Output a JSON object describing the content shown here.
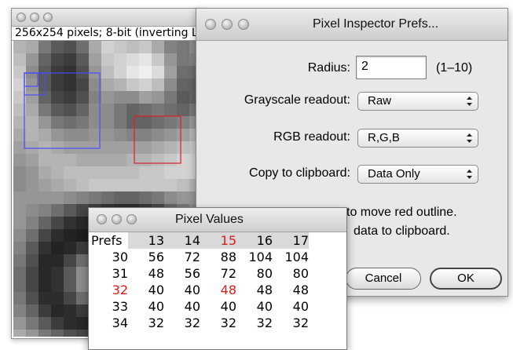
{
  "image_window": {
    "info": "256x254 pixels; 8-bit (inverting LUT)",
    "image_grid": [
      [
        180,
        170,
        120,
        90,
        80,
        110,
        170,
        210,
        200,
        190,
        200,
        170,
        130,
        120,
        140,
        170
      ],
      [
        190,
        150,
        100,
        70,
        60,
        90,
        160,
        200,
        210,
        220,
        230,
        200,
        150,
        120,
        130,
        160
      ],
      [
        200,
        140,
        90,
        60,
        50,
        80,
        150,
        190,
        210,
        230,
        240,
        220,
        160,
        110,
        110,
        150
      ],
      [
        210,
        150,
        90,
        60,
        50,
        70,
        140,
        170,
        180,
        200,
        210,
        190,
        140,
        100,
        100,
        140
      ],
      [
        200,
        160,
        100,
        70,
        60,
        80,
        130,
        150,
        140,
        140,
        160,
        150,
        120,
        90,
        100,
        140
      ],
      [
        190,
        170,
        120,
        90,
        80,
        100,
        140,
        140,
        120,
        100,
        110,
        120,
        110,
        100,
        120,
        160
      ],
      [
        180,
        180,
        150,
        120,
        110,
        120,
        140,
        140,
        120,
        100,
        100,
        110,
        120,
        130,
        150,
        180
      ],
      [
        170,
        180,
        170,
        150,
        140,
        140,
        150,
        150,
        140,
        130,
        130,
        140,
        150,
        160,
        180,
        200
      ],
      [
        160,
        170,
        180,
        170,
        160,
        160,
        160,
        160,
        160,
        160,
        160,
        170,
        180,
        190,
        200,
        210
      ],
      [
        150,
        160,
        180,
        180,
        180,
        170,
        170,
        170,
        170,
        180,
        180,
        190,
        200,
        210,
        210,
        210
      ],
      [
        140,
        150,
        170,
        180,
        190,
        190,
        190,
        190,
        190,
        190,
        200,
        200,
        210,
        210,
        210,
        200
      ],
      [
        140,
        150,
        160,
        170,
        180,
        190,
        200,
        200,
        200,
        200,
        200,
        200,
        200,
        190,
        180,
        170
      ],
      [
        150,
        150,
        150,
        150,
        140,
        130,
        120,
        110,
        100,
        100,
        110,
        120,
        140,
        150,
        150,
        150
      ],
      [
        150,
        140,
        130,
        110,
        90,
        70,
        60,
        50,
        45,
        45,
        55,
        70,
        100,
        120,
        140,
        150
      ],
      [
        150,
        130,
        100,
        70,
        50,
        40,
        35,
        30,
        30,
        30,
        35,
        45,
        70,
        100,
        130,
        150
      ],
      [
        140,
        110,
        70,
        45,
        35,
        30,
        35,
        45,
        50,
        45,
        40,
        40,
        50,
        80,
        120,
        150
      ],
      [
        130,
        90,
        50,
        35,
        40,
        60,
        90,
        110,
        110,
        90,
        60,
        45,
        40,
        60,
        110,
        150
      ],
      [
        120,
        80,
        40,
        40,
        70,
        110,
        150,
        170,
        170,
        150,
        110,
        60,
        40,
        50,
        100,
        150
      ],
      [
        110,
        70,
        40,
        50,
        90,
        140,
        180,
        200,
        200,
        180,
        140,
        80,
        45,
        50,
        100,
        150
      ],
      [
        110,
        70,
        40,
        50,
        90,
        140,
        180,
        200,
        200,
        180,
        140,
        80,
        45,
        55,
        110,
        160
      ],
      [
        120,
        80,
        45,
        45,
        70,
        110,
        150,
        170,
        170,
        150,
        110,
        60,
        45,
        70,
        130,
        170
      ],
      [
        130,
        100,
        60,
        40,
        45,
        60,
        90,
        110,
        110,
        90,
        60,
        45,
        60,
        100,
        150,
        180
      ],
      [
        150,
        120,
        90,
        60,
        45,
        40,
        45,
        50,
        50,
        45,
        45,
        60,
        100,
        140,
        170,
        190
      ],
      [
        170,
        150,
        120,
        100,
        80,
        70,
        60,
        60,
        60,
        70,
        90,
        120,
        150,
        170,
        190,
        200
      ]
    ]
  },
  "prefs_dialog": {
    "title": "Pixel Inspector Prefs...",
    "radius_label": "Radius:",
    "radius_value": "2",
    "radius_range": "(1–10)",
    "grayscale_label": "Grayscale readout:",
    "grayscale_value": "Raw",
    "rgb_label": "RGB readout:",
    "rgb_value": "R,G,B",
    "clipboard_label": "Copy to clipboard:",
    "clipboard_value": "Data Only",
    "hint_line1": "to move red outline.",
    "hint_line2": "data to clipboard.",
    "cancel_label": "Cancel",
    "ok_label": "OK"
  },
  "pixel_values_window": {
    "title": "Pixel Values",
    "corner_label": "Prefs",
    "columns": [
      "13",
      "14",
      "15",
      "16",
      "17"
    ],
    "highlight_column": "15",
    "rows": [
      {
        "y": "30",
        "values": [
          "56",
          "72",
          "88",
          "104",
          "104"
        ]
      },
      {
        "y": "31",
        "values": [
          "48",
          "56",
          "72",
          "80",
          "80"
        ]
      },
      {
        "y": "32",
        "values": [
          "40",
          "40",
          "48",
          "48",
          "48"
        ]
      },
      {
        "y": "33",
        "values": [
          "40",
          "40",
          "40",
          "40",
          "40"
        ]
      },
      {
        "y": "34",
        "values": [
          "32",
          "32",
          "32",
          "32",
          "32"
        ]
      }
    ],
    "highlight_row": "32",
    "colors": {
      "highlight": "#d81e1e"
    }
  }
}
